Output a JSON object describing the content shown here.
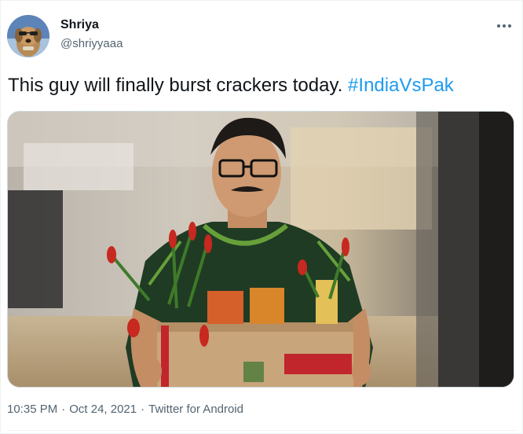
{
  "author": {
    "display_name": "Shriya",
    "handle": "@shriyyaaa",
    "avatar_icon": "dog-avatar-icon"
  },
  "tweet": {
    "text": "This guy will finally burst crackers today.",
    "hashtag": "#IndiaVsPak"
  },
  "media": {
    "description_icon": "photo-man-carrying-firecrackers-box"
  },
  "meta": {
    "time": "10:35 PM",
    "separator": "·",
    "date": "Oct 24, 2021",
    "client": "Twitter for Android"
  },
  "icons": {
    "more": "more-dots-icon"
  },
  "colors": {
    "text": "#0f1419",
    "secondary": "#536471",
    "link": "#1d9bf0",
    "border": "#cfd9de"
  }
}
